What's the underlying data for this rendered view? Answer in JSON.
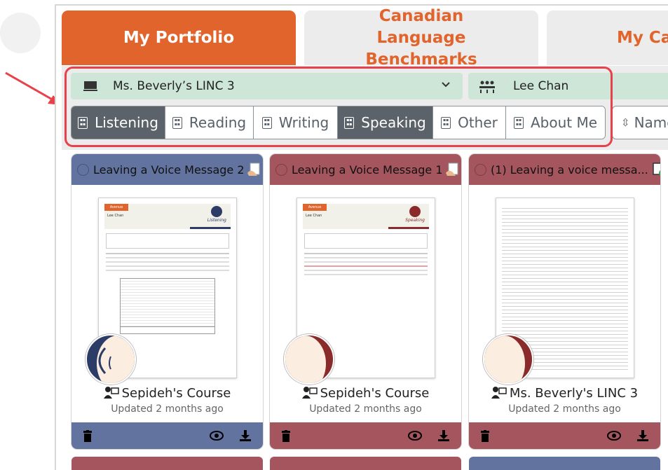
{
  "tabs": [
    {
      "label": "My Portfolio"
    },
    {
      "label": "Canadian Language Benchmarks"
    },
    {
      "label": "My Ca"
    }
  ],
  "filters": {
    "course": "Ms. Beverly’s LINC 3",
    "student": "Lee Chan",
    "sort_label": "Name"
  },
  "skills": [
    {
      "label": "Listening",
      "active": true
    },
    {
      "label": "Reading",
      "active": false
    },
    {
      "label": "Writing",
      "active": false
    },
    {
      "label": "Speaking",
      "active": true
    },
    {
      "label": "Other",
      "active": false
    },
    {
      "label": "About Me",
      "active": false
    }
  ],
  "cards": [
    {
      "title": "Leaving a Voice Message 2",
      "course": "Sepideh's Course",
      "updated": "Updated 2 months ago",
      "skill": "Listening",
      "color": "#61739e",
      "thumb_band": "Avenue",
      "thumb_name": "Lee Chan"
    },
    {
      "title": "Leaving a Voice Message 1",
      "course": "Sepideh's Course",
      "updated": "Updated 2 months ago",
      "skill": "Speaking",
      "color": "#a4555d",
      "thumb_band": "Avenue",
      "thumb_name": "Lee Chan"
    },
    {
      "title": "(1) Leaving a voice messa...",
      "course": "Ms. Beverly's LINC 3",
      "updated": "Updated 2 months ago",
      "skill": "",
      "color": "#a4555d",
      "thumb_band": "",
      "thumb_name": ""
    }
  ],
  "colors": {
    "brand_orange": "#e0642b",
    "select_green": "#cde6d8",
    "highlight_red": "#e8414a",
    "segment_active": "#5b626a"
  }
}
